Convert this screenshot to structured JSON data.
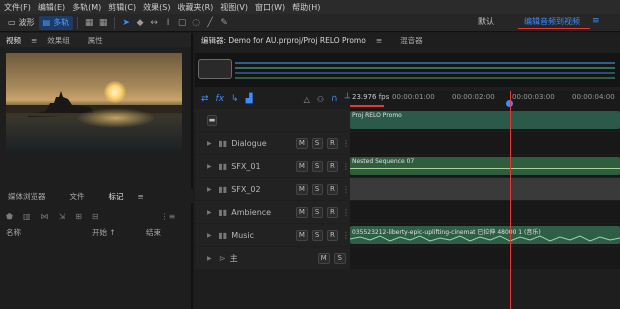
{
  "menu": [
    "文件(F)",
    "编辑(E)",
    "多轨(M)",
    "剪辑(C)",
    "效果(S)",
    "收藏夹(R)",
    "视图(V)",
    "窗口(W)",
    "帮助(H)"
  ],
  "toolbar": {
    "waveform_label": "波形",
    "multitrack_label": "多轨",
    "workspace_default": "默认",
    "workspace_active": "编辑音频到视频",
    "accent": "#3d8cff"
  },
  "left_panel": {
    "tabs": [
      "视频",
      "效果组",
      "属性"
    ],
    "lower_tabs": [
      "媒体浏览器",
      "文件",
      "标记"
    ],
    "marker_columns": [
      "名称",
      "开始",
      "结束"
    ]
  },
  "editor": {
    "tab_title": "编辑器: Demo for AU.prproj/Proj RELO Promo",
    "mixer_tab": "混音器",
    "fps": "23.976 fps",
    "ruler_ticks": [
      "00:00:01:00",
      "00:00:02:00",
      "00:00:03:00",
      "00:00:04:00"
    ]
  },
  "tracks": [
    {
      "name": "",
      "clip": "Proj RELO Promo",
      "color": "#2c5a4a"
    },
    {
      "name": "Dialogue",
      "clip": "",
      "color": ""
    },
    {
      "name": "SFX_01",
      "clip": "Nested Sequence 07",
      "color": "#2f5e3e"
    },
    {
      "name": "SFX_02",
      "clip": "",
      "color": "#3a3a3a"
    },
    {
      "name": "Ambience",
      "clip": "",
      "color": ""
    },
    {
      "name": "Music",
      "clip": "035523212-liberty-epic-uplifting-cinemat 已拉伸 48000 1 (音乐)",
      "color": "#2f5e46"
    },
    {
      "name": "主",
      "clip": "",
      "color": ""
    }
  ],
  "buttons": {
    "m": "M",
    "s": "S",
    "r": "R"
  }
}
